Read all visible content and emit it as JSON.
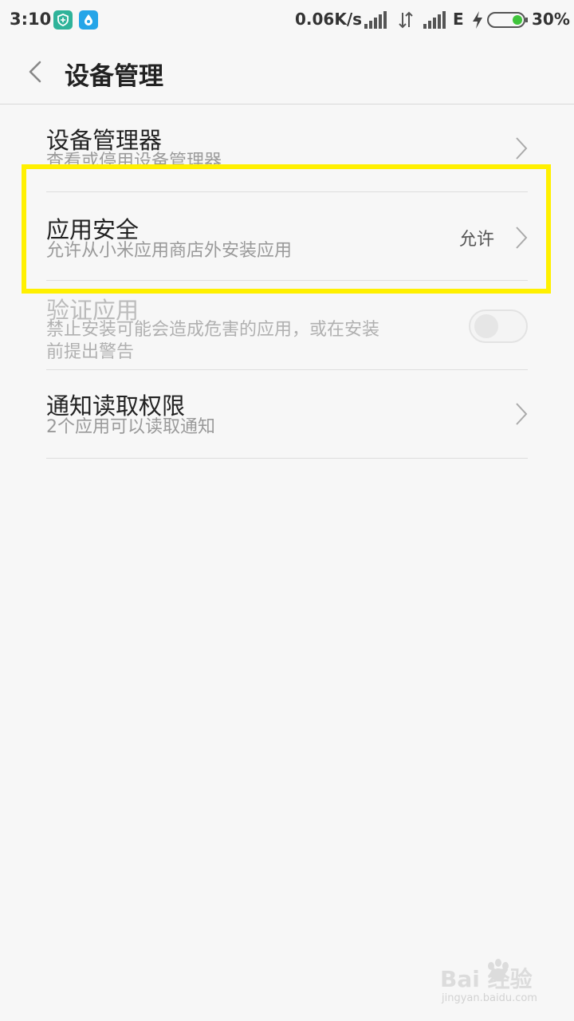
{
  "status_bar": {
    "time": "3:10",
    "net_speed": "0.06K/s",
    "network_type": "E",
    "battery_percent": "30%",
    "battery_level": 0.3,
    "icons": [
      "shield-app-icon",
      "drop-app-icon",
      "signal-icon",
      "data-arrows-icon",
      "signal-icon",
      "charging-icon",
      "battery-icon"
    ],
    "colors": {
      "app1": "#2fb39a",
      "app2": "#25a5e8",
      "battery_fill": "#3fc43b"
    }
  },
  "header": {
    "back_icon": "chevron-left-icon",
    "title": "设备管理"
  },
  "items": [
    {
      "title": "设备管理器",
      "subtitle": "查看或停用设备管理器",
      "control": "chevron"
    },
    {
      "title": "应用安全",
      "subtitle": "允许从小米应用商店外安装应用",
      "value": "允许",
      "control": "chevron"
    },
    {
      "title": "验证应用",
      "subtitle_line1": "禁止安装可能会造成危害的应用，或在安装",
      "subtitle_line2": "前提出警告",
      "control": "toggle",
      "enabled": false,
      "checked": false
    },
    {
      "title": "通知读取权限",
      "subtitle": "2个应用可以读取通知",
      "control": "chevron"
    }
  ],
  "annotation": {
    "highlight_color": "#fff000"
  },
  "watermark": {
    "logo": "Bai 经验",
    "url": "jingyan.baidu.com"
  }
}
